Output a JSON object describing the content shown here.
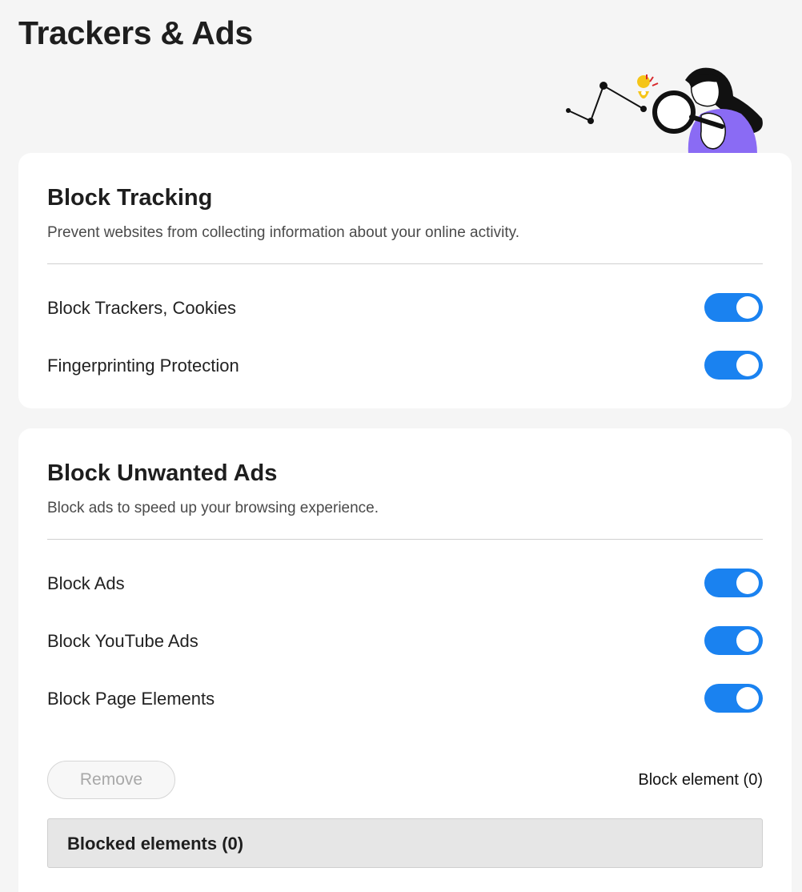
{
  "page": {
    "title": "Trackers & Ads"
  },
  "tracking": {
    "title": "Block Tracking",
    "description": "Prevent websites from collecting information about your online activity.",
    "items": [
      {
        "label": "Block Trackers, Cookies",
        "enabled": true
      },
      {
        "label": "Fingerprinting Protection",
        "enabled": true
      }
    ]
  },
  "ads": {
    "title": "Block Unwanted Ads",
    "description": "Block ads to speed up your browsing experience.",
    "items": [
      {
        "label": "Block Ads",
        "enabled": true
      },
      {
        "label": "Block YouTube Ads",
        "enabled": true
      },
      {
        "label": "Block Page Elements",
        "enabled": true
      }
    ],
    "remove_label": "Remove",
    "block_element_label": "Block element (0)",
    "blocked_elements_header": "Blocked elements (0)"
  },
  "colors": {
    "toggle_on": "#1a82f0",
    "illustration_purple": "#8a6bf4",
    "pin_yellow": "#f5c518"
  },
  "icons": {
    "illustration": "woman-with-magnifier-illustration"
  }
}
